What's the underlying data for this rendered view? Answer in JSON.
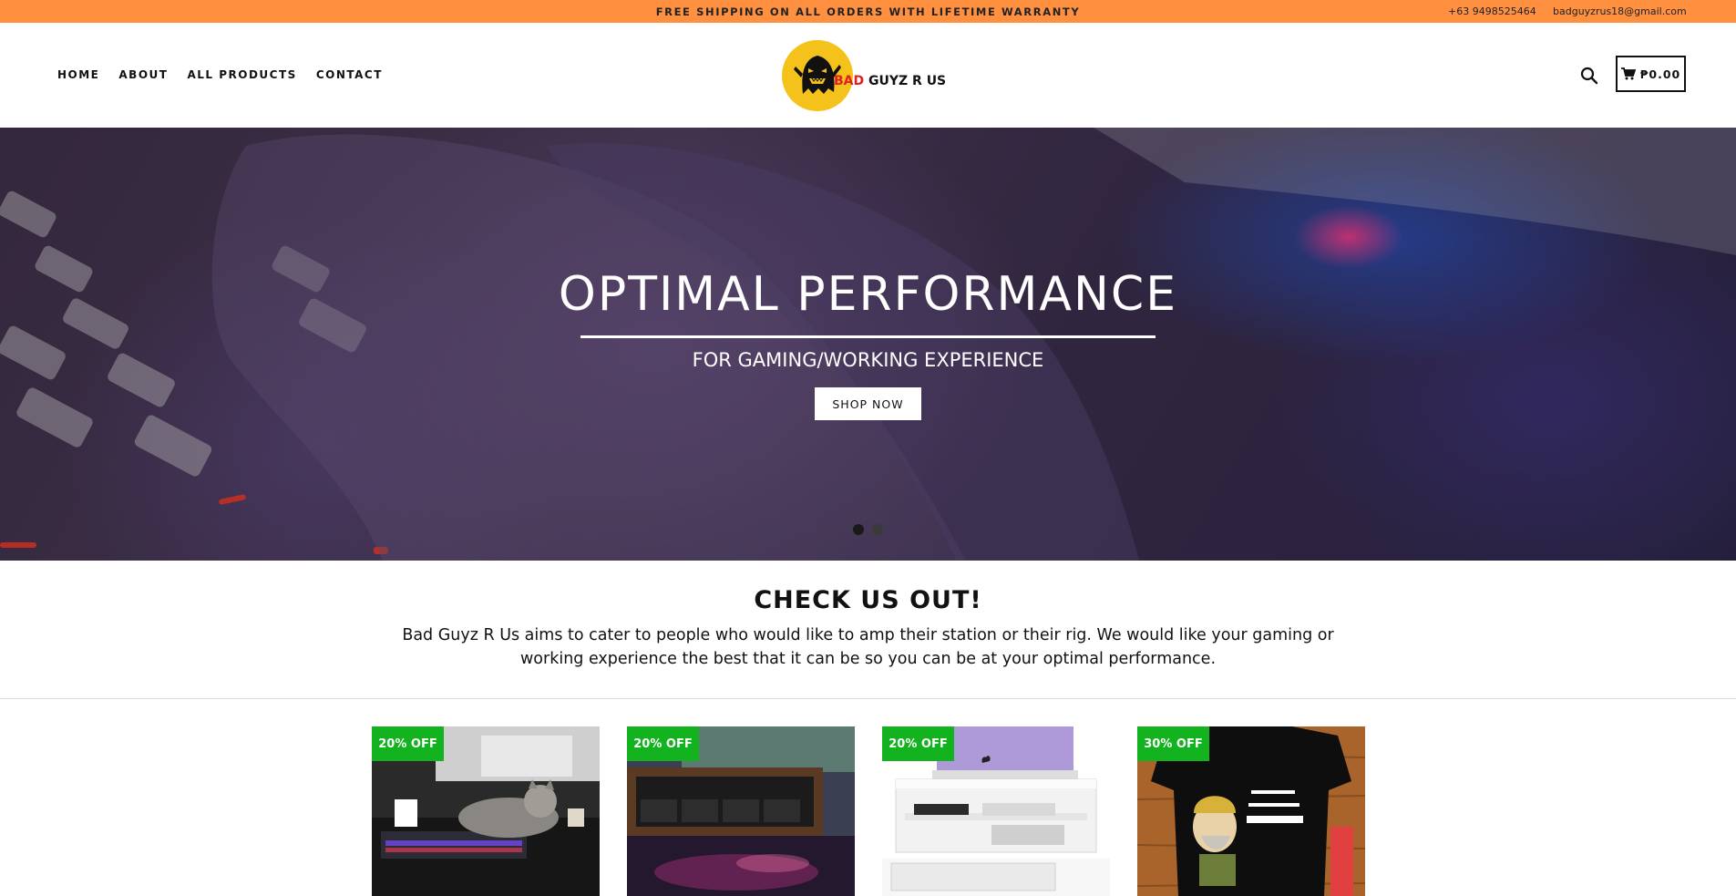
{
  "announcement": {
    "text": "FREE SHIPPING ON ALL ORDERS WITH LIFETIME WARRANTY",
    "phone": "+63 9498525464",
    "email": "badguyzrus18@gmail.com"
  },
  "nav": {
    "items": [
      {
        "label": "HOME"
      },
      {
        "label": "ABOUT"
      },
      {
        "label": "ALL PRODUCTS"
      },
      {
        "label": "CONTACT"
      }
    ]
  },
  "logo": {
    "word_bad": "BAD",
    "word_rest": "GUYZ R US"
  },
  "header": {
    "search_icon": "search-icon",
    "cart_icon": "cart-icon",
    "cart_total": "₱0.00"
  },
  "hero": {
    "title": "OPTIMAL PERFORMANCE",
    "subtitle": "FOR GAMING/WORKING EXPERIENCE",
    "cta_label": "SHOP NOW",
    "slide_count": 2,
    "active_slide": 1
  },
  "about": {
    "heading": "CHECK US OUT!",
    "body": "Bad Guyz R Us aims to cater to people who would like to amp their station or their rig. We would like your gaming or working experience the best that it can be so you can be at your optimal performance."
  },
  "products": [
    {
      "badge": "20% OFF"
    },
    {
      "badge": "20% OFF"
    },
    {
      "badge": "20% OFF"
    },
    {
      "badge": "30% OFF"
    }
  ],
  "colors": {
    "announcement_bg": "#ff9040",
    "badge_green": "#12b31f",
    "logo_red": "#e02020",
    "logo_yellow": "#f5c21b"
  }
}
